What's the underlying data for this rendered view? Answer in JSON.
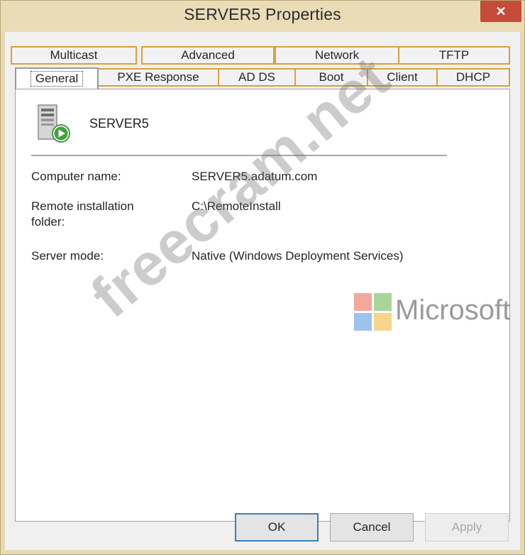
{
  "window": {
    "title": "SERVER5 Properties",
    "close_glyph": "✕"
  },
  "tabs": {
    "row1": [
      {
        "label": "Multicast"
      },
      {
        "label": "Advanced"
      },
      {
        "label": "Network"
      },
      {
        "label": "TFTP"
      }
    ],
    "row2": [
      {
        "label": "General",
        "selected": true
      },
      {
        "label": "PXE Response"
      },
      {
        "label": "AD DS"
      },
      {
        "label": "Boot"
      },
      {
        "label": "Client"
      },
      {
        "label": "DHCP"
      }
    ]
  },
  "general": {
    "server_name": "SERVER5",
    "server_icon": "server-play-icon",
    "fields": [
      {
        "label": "Computer name:",
        "value": "SERVER5.adatum.com"
      },
      {
        "label": "Remote installation\nfolder:",
        "value": "C:\\RemoteInstall"
      },
      {
        "label": "Server mode:",
        "value": "Native (Windows Deployment Services)"
      }
    ]
  },
  "buttons": {
    "ok": "OK",
    "cancel": "Cancel",
    "apply": "Apply"
  },
  "watermark": {
    "text": "freecram.net",
    "brand": "Microsoft"
  },
  "colors": {
    "tab_border": "#d9a13a",
    "close": "#c64b3b",
    "title_bar": "#e9dcb7",
    "default_button_border": "#3c7fb1"
  }
}
